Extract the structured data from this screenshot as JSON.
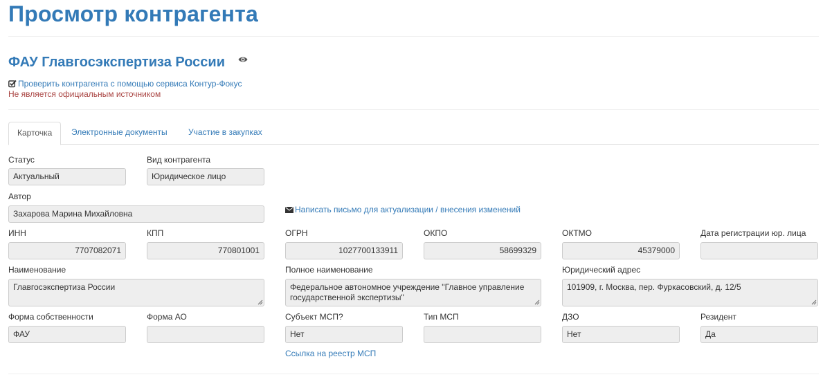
{
  "page": {
    "title": "Просмотр контрагента",
    "org_name": "ФАУ Главгосэкспертиза России",
    "check_link": "Проверить контрагента с помощью сервиса Контур-Фокус",
    "warning": "Не является официальным источником",
    "eye_icon": "eye-icon",
    "check_icon": "check-square-icon",
    "accent_color": "#337ab7",
    "warning_color": "#a94442"
  },
  "tabs": [
    {
      "label": "Карточка",
      "active": true
    },
    {
      "label": "Электронные документы",
      "active": false
    },
    {
      "label": "Участие в закупках",
      "active": false
    }
  ],
  "form": {
    "status": {
      "label": "Статус",
      "value": "Актуальный"
    },
    "kind": {
      "label": "Вид контрагента",
      "value": "Юридическое лицо"
    },
    "author": {
      "label": "Автор",
      "value": "Захарова Марина Михайловна"
    },
    "mail_link": "Написать письмо для актуализации / внесения изменений",
    "mail_icon": "envelope-icon",
    "inn": {
      "label": "ИНН",
      "value": "7707082071"
    },
    "kpp": {
      "label": "КПП",
      "value": "770801001"
    },
    "ogrn": {
      "label": "ОГРН",
      "value": "1027700133911"
    },
    "okpo": {
      "label": "ОКПО",
      "value": "58699329"
    },
    "oktmo": {
      "label": "ОКТМО",
      "value": "45379000"
    },
    "reg_date": {
      "label": "Дата регистрации юр. лица",
      "value": ""
    },
    "name": {
      "label": "Наименование",
      "value": "Главгосэкспертиза России"
    },
    "full_name": {
      "label": "Полное наименование",
      "value": "Федеральное автономное учреждение \"Главное управление государственной экспертизы\""
    },
    "legal_address": {
      "label": "Юридический адрес",
      "value": "101909, г. Москва, пер. Фуркасовский, д. 12/5"
    },
    "ownership": {
      "label": "Форма собственности",
      "value": "ФАУ"
    },
    "ao_form": {
      "label": "Форма АО",
      "value": ""
    },
    "msp_subject": {
      "label": "Субъект МСП?",
      "value": "Нет"
    },
    "msp_type": {
      "label": "Тип МСП",
      "value": ""
    },
    "dzo": {
      "label": "ДЗО",
      "value": "Нет"
    },
    "resident": {
      "label": "Резидент",
      "value": "Да"
    },
    "msp_link": "Ссылка на реестр МСП"
  }
}
